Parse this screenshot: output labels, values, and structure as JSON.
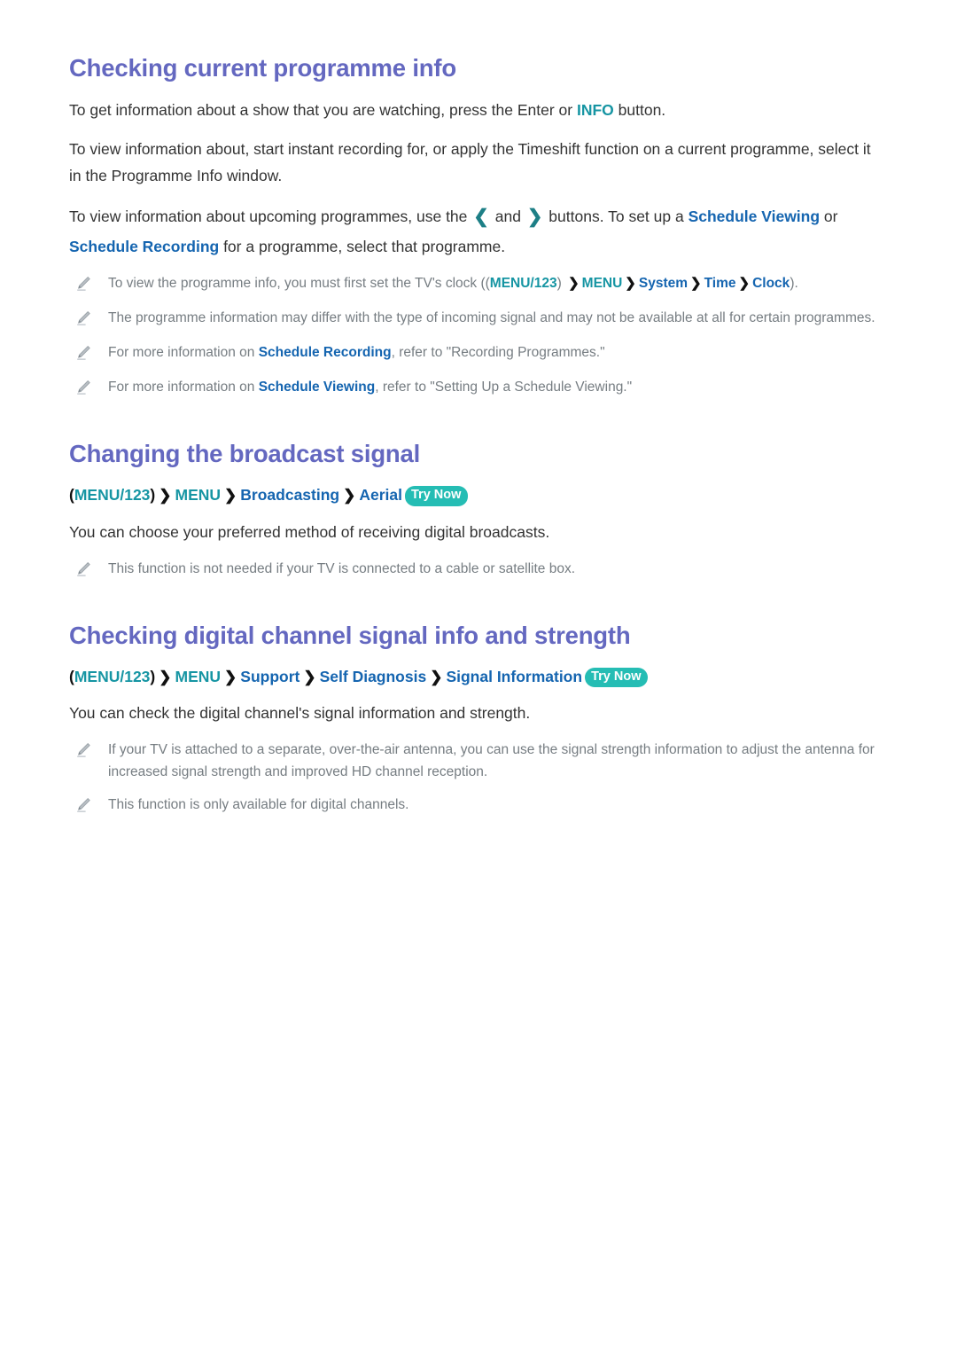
{
  "document": {
    "sections": [
      {
        "id": "checking-current-programme-info",
        "heading": "Checking current programme info",
        "paragraphs": [
          {
            "id": "p1",
            "parts": [
              {
                "type": "text",
                "value": "To get information about a show that you are watching, press the Enter or "
              },
              {
                "type": "link-teal",
                "value": "INFO"
              },
              {
                "type": "text",
                "value": " button."
              }
            ]
          },
          {
            "id": "p2",
            "parts": [
              {
                "type": "text",
                "value": "To view information about, start instant recording for, or apply the Timeshift function on a current programme, select it in the Programme Info window."
              }
            ]
          },
          {
            "id": "p3",
            "parts": [
              {
                "type": "text",
                "value": "To view information about upcoming programmes, use the "
              },
              {
                "type": "arrow",
                "value": "❮"
              },
              {
                "type": "text",
                "value": " and "
              },
              {
                "type": "arrow",
                "value": "❯"
              },
              {
                "type": "text",
                "value": " buttons. To set up a "
              },
              {
                "type": "link",
                "value": "Schedule Viewing"
              },
              {
                "type": "text",
                "value": " or "
              },
              {
                "type": "link",
                "value": "Schedule Recording"
              },
              {
                "type": "text",
                "value": " for a programme, select that programme."
              }
            ]
          }
        ],
        "notes": [
          {
            "id": "n1",
            "parts": [
              {
                "type": "text",
                "value": "To view the programme info, you must first set the TV's clock (("
              },
              {
                "type": "link-teal",
                "value": "MENU/123"
              },
              {
                "type": "text",
                "value": ") "
              },
              {
                "type": "chevron",
                "value": "❯"
              },
              {
                "type": "link-teal",
                "value": "MENU"
              },
              {
                "type": "chevron",
                "value": "❯"
              },
              {
                "type": "link",
                "value": "System"
              },
              {
                "type": "chevron",
                "value": "❯"
              },
              {
                "type": "link",
                "value": "Time"
              },
              {
                "type": "chevron",
                "value": "❯"
              },
              {
                "type": "link",
                "value": "Clock"
              },
              {
                "type": "text",
                "value": ")."
              }
            ]
          },
          {
            "id": "n2",
            "parts": [
              {
                "type": "text",
                "value": "The programme information may differ with the type of incoming signal and may not be available at all for certain programmes."
              }
            ]
          },
          {
            "id": "n3",
            "parts": [
              {
                "type": "text",
                "value": "For more information on "
              },
              {
                "type": "link",
                "value": "Schedule Recording"
              },
              {
                "type": "text",
                "value": ", refer to \"Recording Programmes.\""
              }
            ]
          },
          {
            "id": "n4",
            "parts": [
              {
                "type": "text",
                "value": "For more information on "
              },
              {
                "type": "link",
                "value": "Schedule Viewing"
              },
              {
                "type": "text",
                "value": ", refer to \"Setting Up a Schedule Viewing.\""
              }
            ]
          }
        ]
      },
      {
        "id": "changing-the-broadcast-signal",
        "heading": "Changing the broadcast signal",
        "breadcrumb": {
          "parts": [
            {
              "type": "paren",
              "value": "("
            },
            {
              "type": "link-teal",
              "value": "MENU/123"
            },
            {
              "type": "paren",
              "value": ")"
            },
            {
              "type": "chevron",
              "value": "❯"
            },
            {
              "type": "link-teal",
              "value": "MENU"
            },
            {
              "type": "chevron",
              "value": "❯"
            },
            {
              "type": "link",
              "value": "Broadcasting"
            },
            {
              "type": "chevron",
              "value": "❯"
            },
            {
              "type": "link",
              "value": "Aerial"
            },
            {
              "type": "badge",
              "value": "Try Now"
            }
          ]
        },
        "paragraphs": [
          {
            "id": "p1",
            "parts": [
              {
                "type": "text",
                "value": "You can choose your preferred method of receiving digital broadcasts."
              }
            ]
          }
        ],
        "notes": [
          {
            "id": "n1",
            "parts": [
              {
                "type": "text",
                "value": "This function is not needed if your TV is connected to a cable or satellite box."
              }
            ]
          }
        ]
      },
      {
        "id": "checking-digital-channel-signal-info-and-strength",
        "heading": "Checking digital channel signal info and strength",
        "breadcrumb": {
          "parts": [
            {
              "type": "paren",
              "value": "("
            },
            {
              "type": "link-teal",
              "value": "MENU/123"
            },
            {
              "type": "paren",
              "value": ")"
            },
            {
              "type": "chevron",
              "value": "❯"
            },
            {
              "type": "link-teal",
              "value": "MENU"
            },
            {
              "type": "chevron",
              "value": "❯"
            },
            {
              "type": "link",
              "value": "Support"
            },
            {
              "type": "chevron",
              "value": "❯"
            },
            {
              "type": "link",
              "value": "Self Diagnosis"
            },
            {
              "type": "chevron",
              "value": "❯"
            },
            {
              "type": "link",
              "value": "Signal Information"
            },
            {
              "type": "badge",
              "value": "Try Now"
            }
          ]
        },
        "paragraphs": [
          {
            "id": "p1",
            "parts": [
              {
                "type": "text",
                "value": "You can check the digital channel's signal information and strength."
              }
            ]
          }
        ],
        "notes": [
          {
            "id": "n1",
            "parts": [
              {
                "type": "text",
                "value": "If your TV is attached to a separate, over-the-air antenna, you can use the signal strength information to adjust the antenna for increased signal strength and improved HD channel reception."
              }
            ]
          },
          {
            "id": "n2",
            "parts": [
              {
                "type": "text",
                "value": "This function is only available for digital channels."
              }
            ]
          }
        ]
      }
    ]
  },
  "icons": {
    "note_icon_name": "pencil-icon"
  },
  "colors": {
    "heading": "#6468c0",
    "link_blue": "#1565b0",
    "link_teal": "#1695a3",
    "badge_bg": "#25bdb4",
    "note_text": "#767d82",
    "body_text": "#333333"
  }
}
